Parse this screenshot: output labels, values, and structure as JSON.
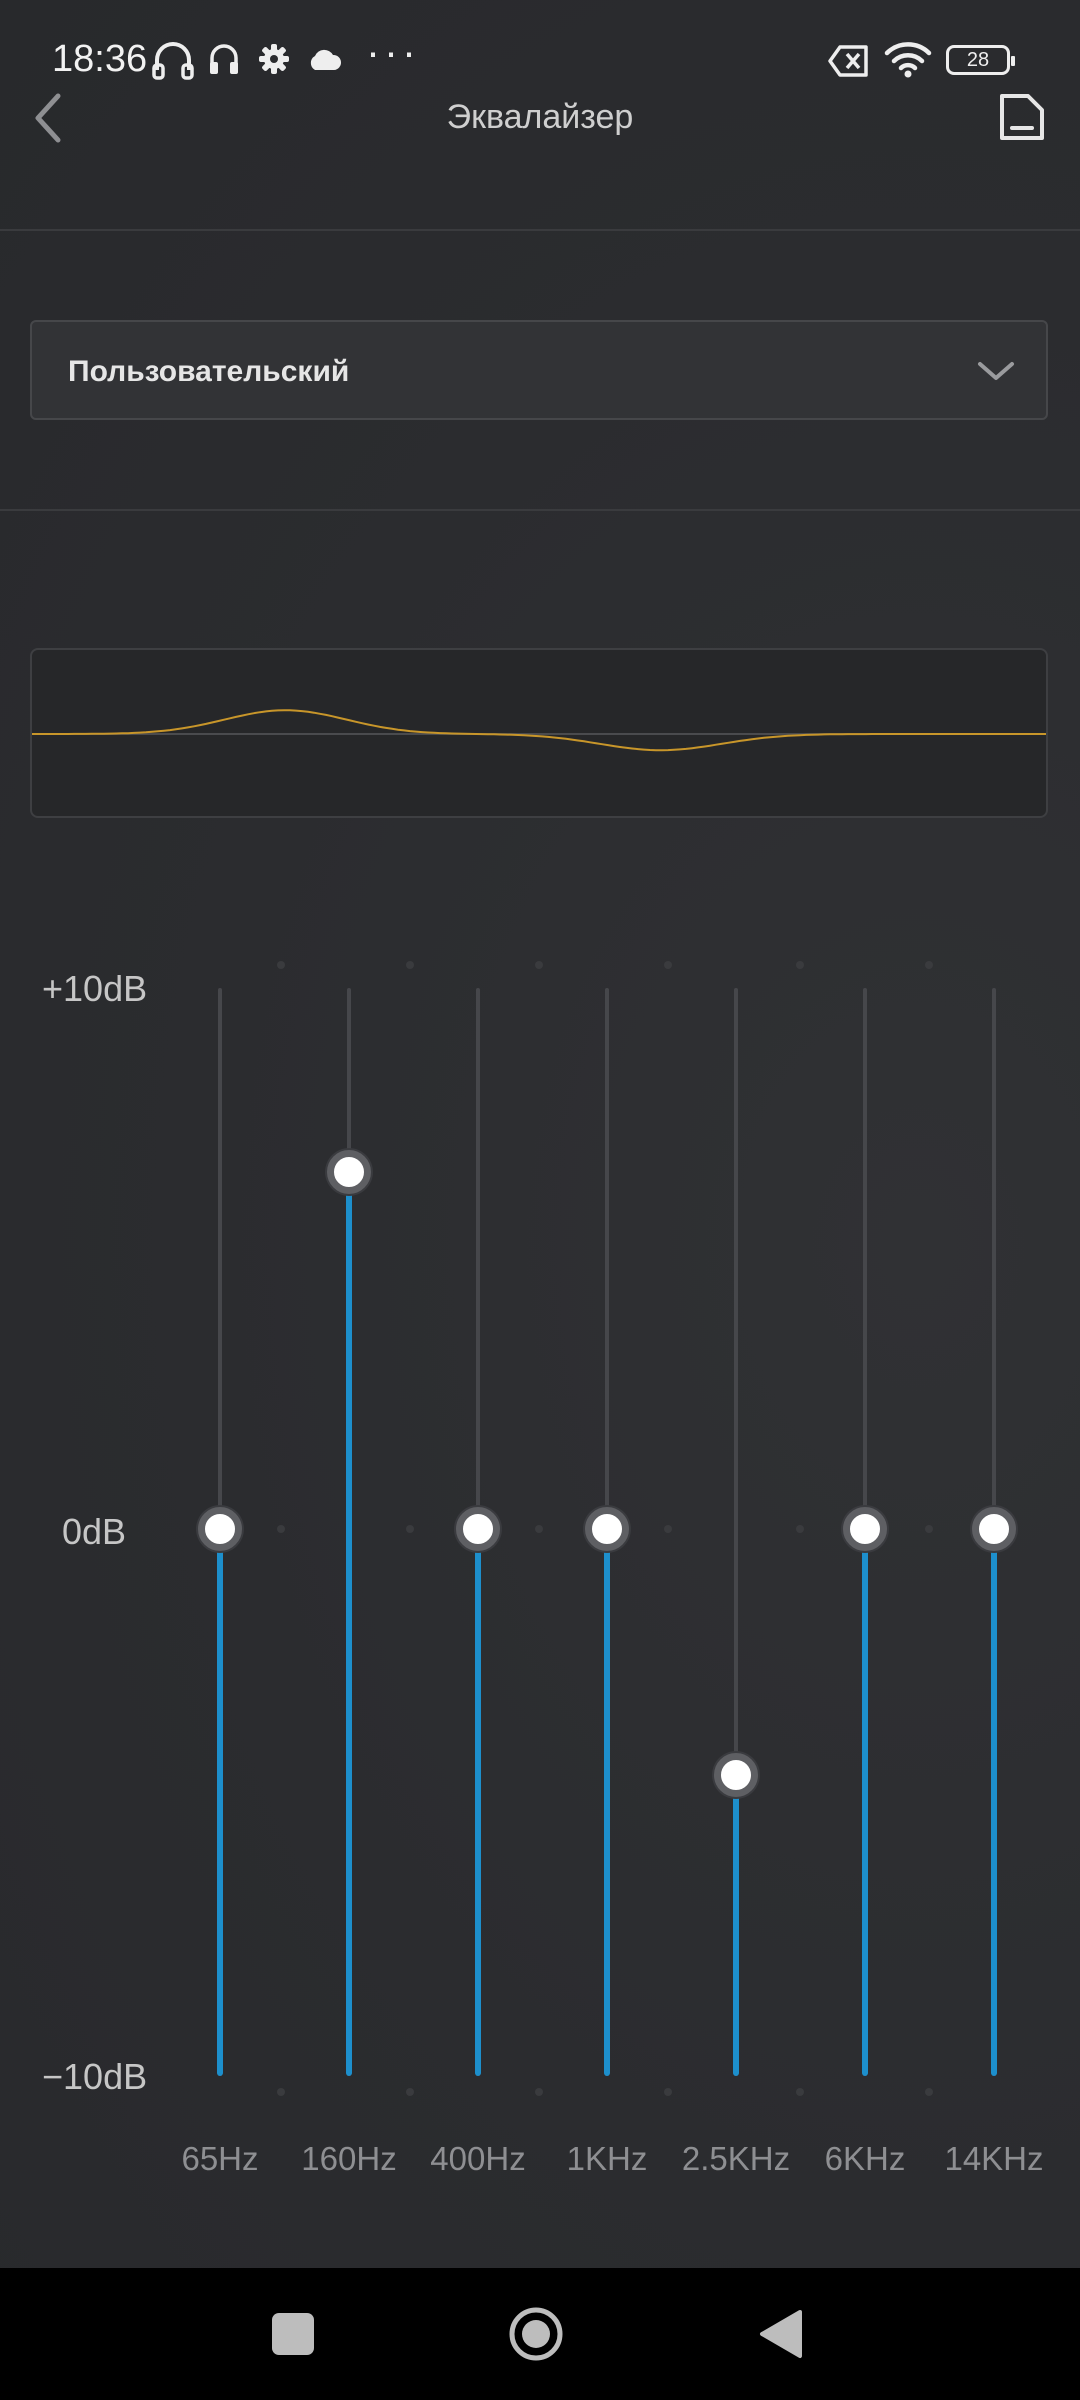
{
  "status_bar": {
    "time": "18:36",
    "icons": [
      "headphones-outline-icon",
      "headphones-icon",
      "gear-icon",
      "cloud-icon",
      "more-dots-icon",
      "no-sim-icon",
      "wifi-icon"
    ],
    "more": "···",
    "battery": "28"
  },
  "header": {
    "title": "Эквалайзер",
    "back_icon": "chevron-left-icon",
    "save_icon": "save-icon"
  },
  "preset": {
    "selected": "Пользовательский",
    "icon": "chevron-down-icon"
  },
  "colors": {
    "accent": "#1d8fcc",
    "curve": "#c8962a",
    "background": "#2b2c2f"
  },
  "eq": {
    "db_max_label": "+10dB",
    "db_mid_label": "0dB",
    "db_min_label": "−10dB",
    "range_db": [
      -10,
      10
    ],
    "bands": [
      {
        "label": "65Hz",
        "gain_db": 0
      },
      {
        "label": "160Hz",
        "gain_db": 6.6
      },
      {
        "label": "400Hz",
        "gain_db": 0
      },
      {
        "label": "1KHz",
        "gain_db": 0
      },
      {
        "label": "2.5KHz",
        "gain_db": -4.5
      },
      {
        "label": "6KHz",
        "gain_db": 0
      },
      {
        "label": "14KHz",
        "gain_db": 0
      }
    ]
  }
}
